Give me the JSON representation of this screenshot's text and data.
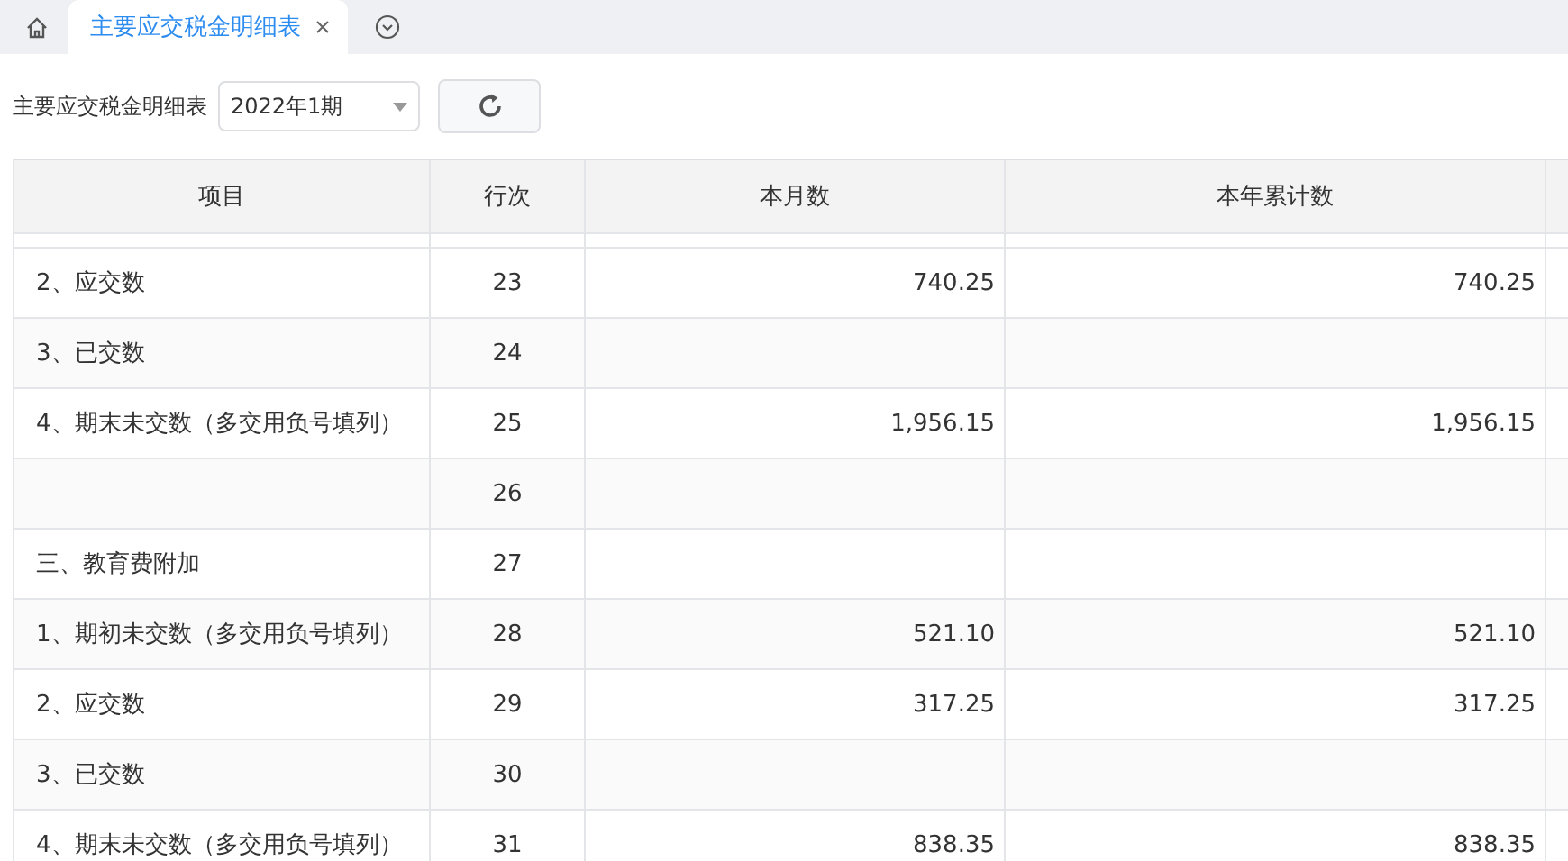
{
  "tabs": [
    {
      "kind": "home",
      "selected": false
    },
    {
      "kind": "page",
      "label": "主要应交税金明细表",
      "selected": true
    }
  ],
  "toolbar": {
    "label": "主要应交税金明细表",
    "period": "2022年1期"
  },
  "table": {
    "columns": [
      "项目",
      "行次",
      "本月数",
      "本年累计数"
    ],
    "rows": [
      [
        "2、应交数",
        "23",
        "740.25",
        "740.25"
      ],
      [
        "3、已交数",
        "24",
        "",
        ""
      ],
      [
        "4、期末未交数（多交用负号填列）",
        "25",
        "1,956.15",
        "1,956.15"
      ],
      [
        "",
        "26",
        "",
        ""
      ],
      [
        "三、教育费附加",
        "27",
        "",
        ""
      ],
      [
        "1、期初未交数（多交用负号填列）",
        "28",
        "521.10",
        "521.10"
      ],
      [
        "2、应交数",
        "29",
        "317.25",
        "317.25"
      ],
      [
        "3、已交数",
        "30",
        "",
        ""
      ],
      [
        "4、期末未交数（多交用负号填列）",
        "31",
        "838.35",
        "838.35"
      ]
    ]
  }
}
